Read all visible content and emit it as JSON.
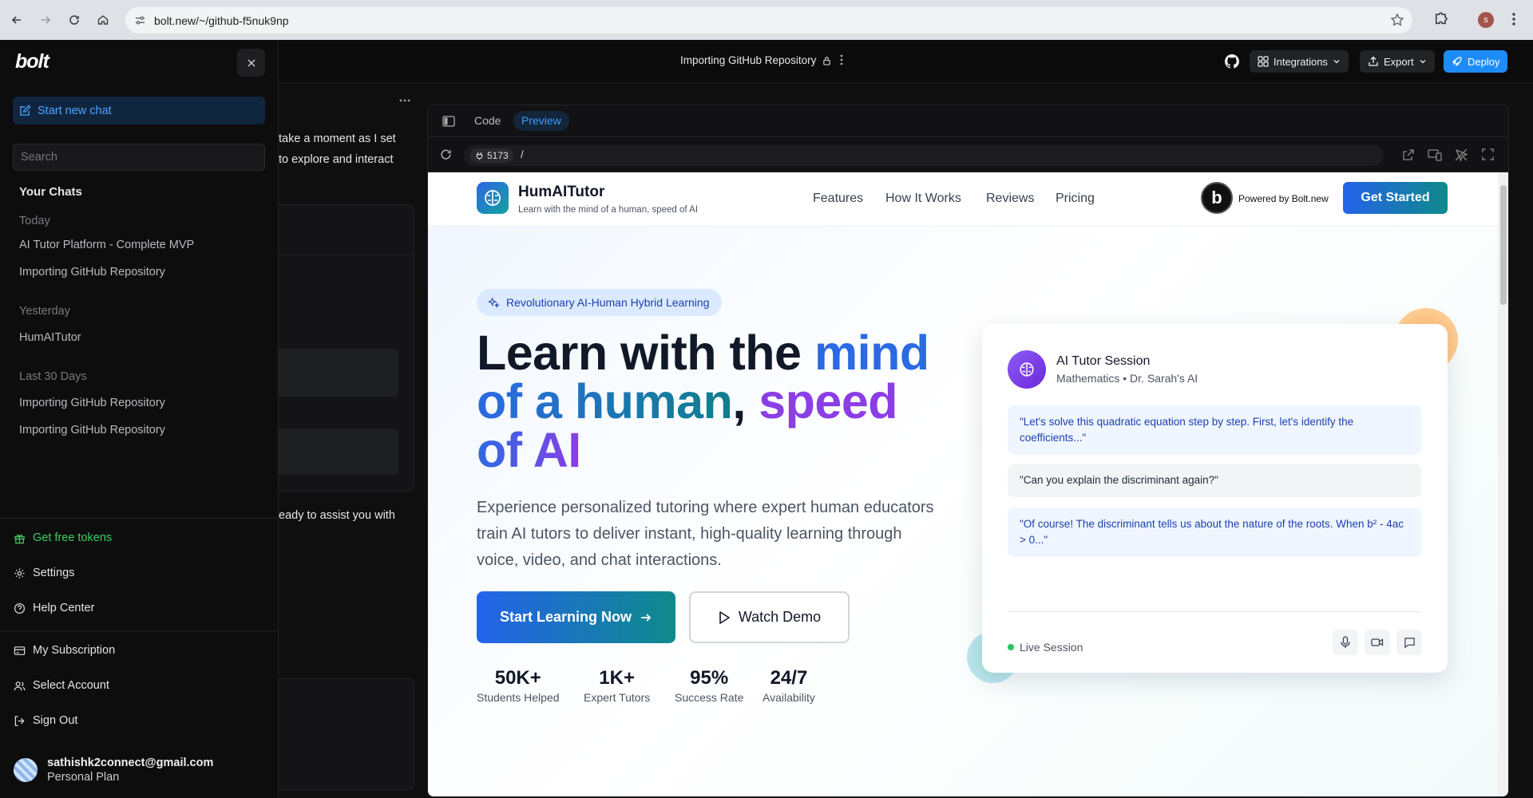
{
  "browser": {
    "url": "bolt.new/~/github-f5nuk9np",
    "profile_initial": "s"
  },
  "header": {
    "project_title": "Importing GitHub Repository",
    "integrations_label": "Integrations",
    "export_label": "Export",
    "deploy_label": "Deploy"
  },
  "chat": {
    "line1": "take a moment as I set",
    "line2": "to explore and interact",
    "line3": "eady to assist you with"
  },
  "workbench": {
    "tabs": [
      "Code",
      "Preview"
    ],
    "active_tab": "Preview",
    "port": "5173",
    "path": "/"
  },
  "site": {
    "brand": "HumAITutor",
    "tagline": "Learn with the mind of a human, speed of AI",
    "nav": [
      "Features",
      "How It Works",
      "Reviews",
      "Pricing"
    ],
    "powered_by": "Powered by Bolt.new",
    "badge_letter": "b",
    "get_started": "Get Started",
    "pill": "Revolutionary AI-Human Hybrid Learning",
    "hero": {
      "part1": "Learn with the ",
      "part2": "mind",
      "part3": "of a human",
      "part4": ", ",
      "part5": "speed",
      "part6": "of AI"
    },
    "subtitle": "Experience personalized tutoring where expert human educators train AI tutors to deliver instant, high-quality learning through voice, video, and chat interactions.",
    "cta_primary": "Start Learning Now",
    "cta_secondary": "Watch Demo",
    "stats": [
      {
        "value": "50K+",
        "label": "Students Helped"
      },
      {
        "value": "1K+",
        "label": "Expert Tutors"
      },
      {
        "value": "95%",
        "label": "Success Rate"
      },
      {
        "value": "24/7",
        "label": "Availability"
      }
    ],
    "card": {
      "title": "AI Tutor Session",
      "subtitle": "Mathematics • Dr. Sarah's AI",
      "messages": [
        "\"Let's solve this quadratic equation step by step. First, let's identify the coefficients...\"",
        "\"Can you explain the discriminant again?\"",
        "\"Of course! The discriminant tells us about the nature of the roots. When b² - 4ac > 0...\""
      ],
      "status": "Live Session"
    }
  },
  "sidebar": {
    "logo": "bolt",
    "new_chat": "Start new chat",
    "search_placeholder": "Search",
    "your_chats": "Your Chats",
    "groups": [
      {
        "label": "Today",
        "items": [
          "AI Tutor Platform - Complete MVP",
          "Importing GitHub Repository"
        ]
      },
      {
        "label": "Yesterday",
        "items": [
          "HumAITutor"
        ]
      },
      {
        "label": "Last 30 Days",
        "items": [
          "Importing GitHub Repository",
          "Importing GitHub Repository"
        ]
      }
    ],
    "footer": [
      "Get free tokens",
      "Settings",
      "Help Center",
      "My Subscription",
      "Select Account",
      "Sign Out"
    ],
    "user_email": "sathishk2connect@gmail.com",
    "user_plan": "Personal Plan"
  },
  "colors": {
    "accent": "#1d8cf8",
    "brand_blue": "#2563eb",
    "brand_teal": "#0e8a8a",
    "purple": "#8b3ee6",
    "free_tokens_green": "#3ccf62"
  }
}
